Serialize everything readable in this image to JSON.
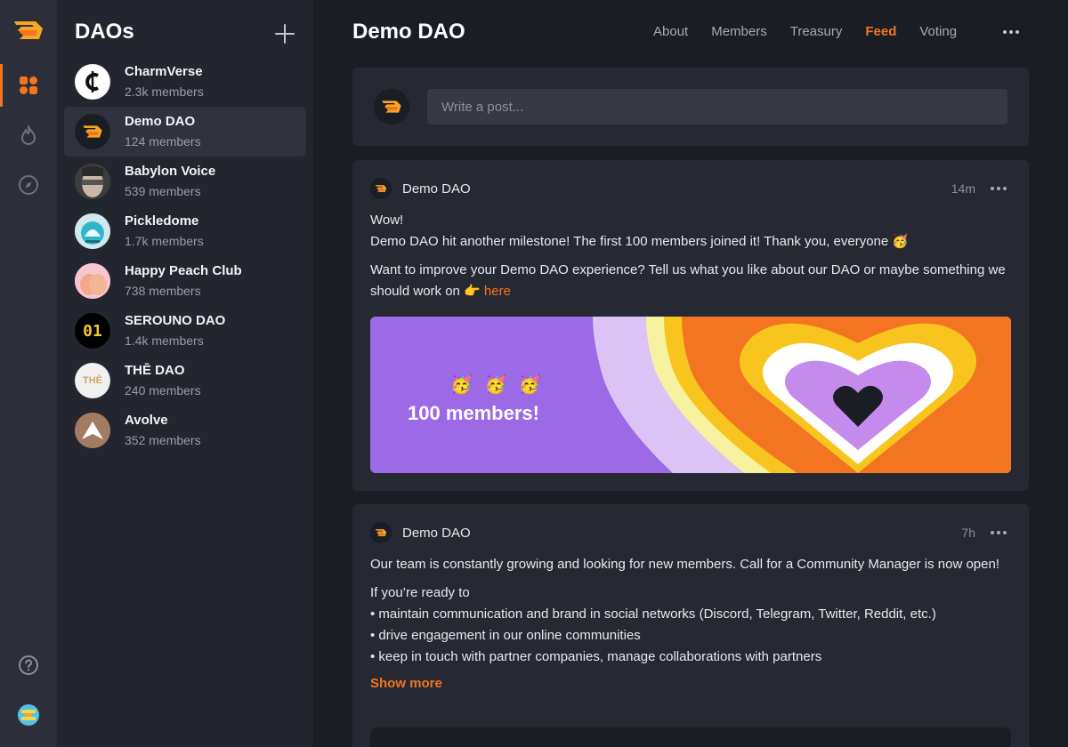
{
  "sidebar": {
    "header": "DAOs",
    "items": [
      {
        "name": "CharmVerse",
        "members": "2.3k members"
      },
      {
        "name": "Demo DAO",
        "members": "124 members"
      },
      {
        "name": "Babylon Voice",
        "members": "539 members"
      },
      {
        "name": "Pickledome",
        "members": "1.7k members"
      },
      {
        "name": "Happy Peach Club",
        "members": "738 members"
      },
      {
        "name": "SEROUNO DAO",
        "members": "1.4k members"
      },
      {
        "name": "THĒ DAO",
        "members": "240 members"
      },
      {
        "name": "Avolve",
        "members": "352 members"
      }
    ],
    "avatar_text": {
      "serouno": "01",
      "the": "THĒ"
    }
  },
  "header": {
    "title": "Demo DAO",
    "tabs": [
      "About",
      "Members",
      "Treasury",
      "Feed",
      "Voting"
    ],
    "active_tab": "Feed"
  },
  "composer": {
    "placeholder": "Write a post..."
  },
  "posts": [
    {
      "author": "Demo DAO",
      "time": "14m",
      "lines": [
        "Wow!",
        "Demo DAO hit another milestone! The first 100 members joined it! Thank you, everyone 🥳",
        "Want to improve your Demo DAO experience? Tell us what you like about our DAO or maybe something we should work on 👉"
      ],
      "link_text": "here",
      "banner": {
        "emojis": "🥳 🥳 🥳",
        "text": "100 members!"
      }
    },
    {
      "author": "Demo DAO",
      "time": "7h",
      "intro": "Our team is constantly growing and looking for new members. Call for a Community Manager is now open!",
      "lead": "If you’re ready to",
      "bullets": [
        "• maintain communication and brand in social networks (Discord, Telegram, Twitter, Reddit, etc.)",
        "• drive engagement in our online communities",
        "• keep in touch with partner companies, manage collaborations with partners"
      ],
      "show_more": "Show more"
    }
  ],
  "colors": {
    "accent": "#f37521",
    "rail": "#2c2f39",
    "sidebar": "#23262e",
    "card": "#262932",
    "bg": "#1b1d24"
  }
}
